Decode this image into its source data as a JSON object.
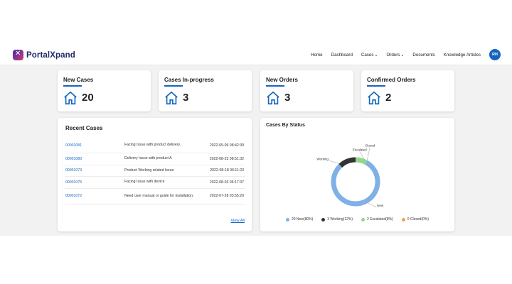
{
  "brand": {
    "name": "PortalXpand"
  },
  "nav": {
    "items": [
      {
        "label": "Home",
        "has_caret": false
      },
      {
        "label": "Dashboard",
        "has_caret": false
      },
      {
        "label": "Cases",
        "has_caret": true
      },
      {
        "label": "Orders",
        "has_caret": true
      },
      {
        "label": "Documents",
        "has_caret": false
      },
      {
        "label": "Knowledge Articles",
        "has_caret": false
      }
    ],
    "avatar_initials": "RH"
  },
  "stats": [
    {
      "title": "New Cases",
      "value": "20",
      "icon": "home-icon"
    },
    {
      "title": "Cases In-progress",
      "value": "3",
      "icon": "home-icon"
    },
    {
      "title": "New Orders",
      "value": "3",
      "icon": "home-icon"
    },
    {
      "title": "Confirmed Orders",
      "value": "2",
      "icon": "home-icon"
    }
  ],
  "recent_cases": {
    "title": "Recent Cases",
    "rows": [
      {
        "id": "00001081",
        "description": "Facing Issue with product delivery.",
        "date": "2022-09-09 08:42:39"
      },
      {
        "id": "00001080",
        "description": "Delivery Issue with product A",
        "date": "2022-08-23 08:51:32"
      },
      {
        "id": "00001073",
        "description": "Product Working related Issue",
        "date": "2022-08-18 06:11:23"
      },
      {
        "id": "00001075",
        "description": "Facing Issue with device",
        "date": "2022-08-03 06:17:37"
      },
      {
        "id": "00001072",
        "description": "Need user manual or guide for installation.",
        "date": "2022-07-28 03:55:20"
      }
    ],
    "view_all": "View All"
  },
  "colors": {
    "accent": "#1565c0",
    "new": "#7fb0e6",
    "working": "#333333",
    "escalated": "#8fd68f",
    "closed": "#f0a050"
  },
  "cases_by_status": {
    "title": "Cases By Status",
    "chart_data": {
      "type": "pie",
      "series": [
        {
          "name": "New",
          "value": 20,
          "color": "#7fb0e6"
        },
        {
          "name": "Working",
          "value": 3,
          "color": "#333333"
        },
        {
          "name": "Escalated",
          "value": 2,
          "color": "#8fd68f"
        },
        {
          "name": "Closed",
          "value": 0,
          "color": "#f0a050"
        }
      ],
      "slice_labels": [
        "New",
        "Working",
        "Escalated",
        "Closed"
      ],
      "legend": [
        "20 New(80%)",
        "3 Working(12%)",
        "2 Escalated(8%)",
        "0 Closed(0%)"
      ],
      "legend_position": "bottom"
    }
  }
}
